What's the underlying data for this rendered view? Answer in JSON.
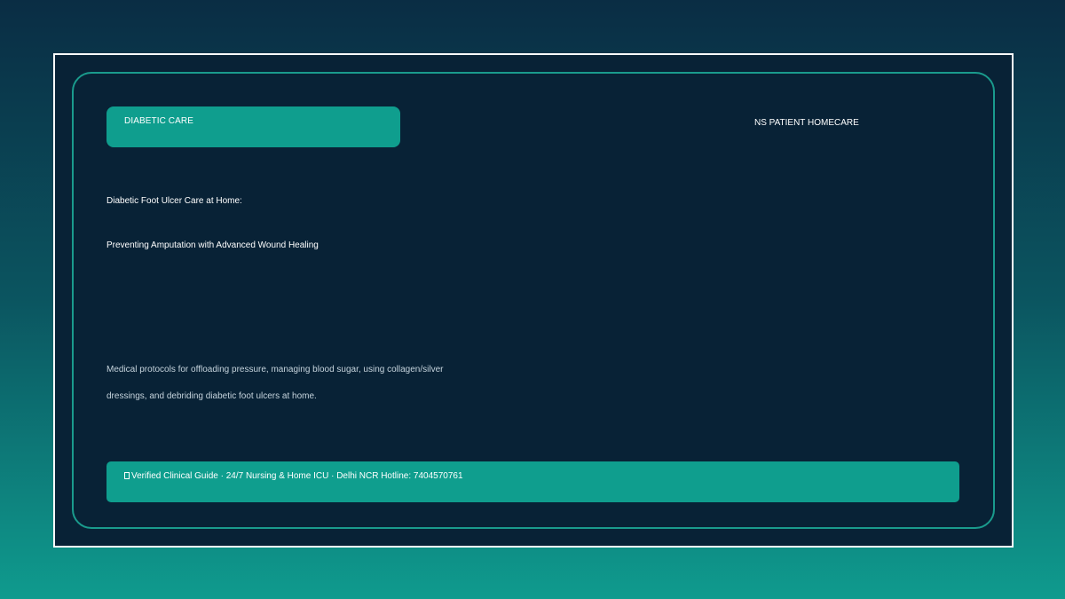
{
  "header": {
    "category": "DIABETIC CARE",
    "brand": "NS PATIENT HOMECARE"
  },
  "main": {
    "title_line1": "Diabetic Foot Ulcer Care at Home:",
    "title_line2": "Preventing Amputation with Advanced Wound Healing",
    "description_line1": "Medical protocols for offloading pressure, managing blood sugar, using collagen/silver",
    "description_line2": "dressings, and debriding diabetic foot ulcers at home."
  },
  "footer": {
    "icon": "check-box-icon",
    "text": "Verified Clinical Guide · 24/7 Nursing & Home ICU · Delhi NCR Hotline: 7404570761"
  },
  "colors": {
    "background_top": "#0a2d44",
    "background_bottom": "#0f9b8e",
    "card": "#082236",
    "accent": "#0f9e8e",
    "border": "#1a9b8d"
  }
}
